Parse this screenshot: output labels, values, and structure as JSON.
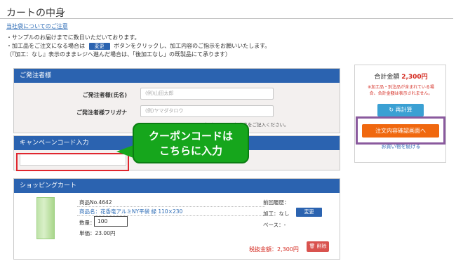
{
  "page_title": "カートの中身",
  "bag_link": "当社袋についてのご注意",
  "notes": {
    "line1": "・サンプルのお届けまでに数日いただいております。",
    "line2_prefix": "・加工品をご注文になる場合は",
    "line2_btn": "変更",
    "line2_suffix": "ボタンをクリックし、加工内容のご指示をお願いいたします。",
    "line3": "（『加工：なし』表示のままレジへ進んだ場合は、「後加工なし」の既製品にて承ります）"
  },
  "orderer": {
    "heading": "ご発注者様",
    "name_label": "ご発注者様(氏名)",
    "name_placeholder": "(例)山田太郎",
    "kana_label": "ご発注者様フリガナ",
    "kana_placeholder": "(例)ヤマダタロウ",
    "note": "がありますので個人名をご記入ください。"
  },
  "campaign": {
    "heading": "キャンペーンコード入力",
    "value": ""
  },
  "callout": {
    "line1": "クーポンコードは",
    "line2": "こちらに入力"
  },
  "cart": {
    "heading": "ショッピングカート",
    "product_no": "商品No.4642",
    "product_name": "商品名：花香竜アルミNY平袋 緑 110×230",
    "qty_label": "数量：",
    "qty_value": "100",
    "unit_price": "単価：23.00円",
    "prev_history": "前回履歴：",
    "processing": "加工：なし",
    "change_btn": "変更",
    "base": "ベース：-",
    "price": "税抜金額：2,300円",
    "delete_btn": "削除"
  },
  "side": {
    "total_label": "合計金額",
    "total_value": "2,300円",
    "note_line1": "※加工品・別注品が含まれている場",
    "note_line2": "合、合計金額は表示されません。",
    "recalc_btn": "再計算",
    "confirm_btn": "注文内容確認画面へ",
    "continue_link": "お買い物を続ける"
  },
  "colors": {
    "header_blue": "#2b63b0",
    "callout_green": "#16a61c",
    "accent_orange": "#f0680f",
    "price_red": "#d42a20",
    "highlight_red": "#e0262e",
    "frame_purple": "#8a5a9e"
  },
  "icons": {
    "recalc": "refresh-icon",
    "delete": "trash-icon"
  }
}
